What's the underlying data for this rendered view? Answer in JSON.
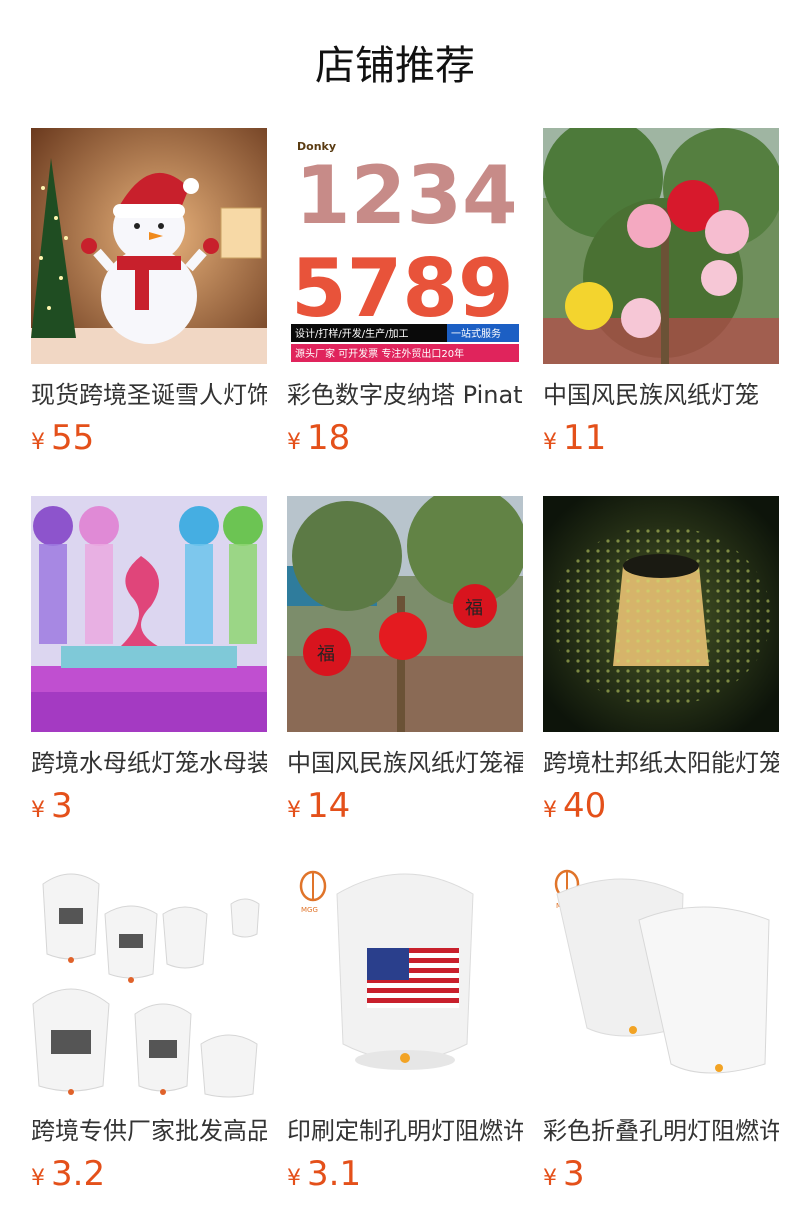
{
  "section_title": "店铺推荐",
  "currency_symbol": "¥",
  "accent_color": "#e4501a",
  "products": [
    {
      "name": "现货跨境圣诞雪人灯饰",
      "price": "55",
      "image": "snowman-lamp-image"
    },
    {
      "name": "彩色数字皮纳塔 Pinata",
      "price": "18",
      "image": "number-pinata-image"
    },
    {
      "name": "中国风民族风纸灯笼",
      "price": "11",
      "image": "paper-lantern-tree-image",
      "image_text": {
        "banner1": "设计/打样/开发/生产/加工",
        "banner2": "一站式服务"
      }
    },
    {
      "name": "跨境水母纸灯笼水母装饰",
      "price": "3",
      "image": "jellyfish-lantern-image"
    },
    {
      "name": "中国风民族风纸灯笼福字",
      "price": "14",
      "image": "fu-lantern-image"
    },
    {
      "name": "跨境杜邦纸太阳能灯笼",
      "price": "40",
      "image": "solar-lantern-image"
    },
    {
      "name": "跨境专供厂家批发高品质孔明灯",
      "price": "3.2",
      "image": "sky-lanterns-image"
    },
    {
      "name": "印刷定制孔明灯阻燃许愿灯",
      "price": "3.1",
      "image": "flag-sky-lantern-image"
    },
    {
      "name": "彩色折叠孔明灯阻燃许愿灯",
      "price": "3",
      "image": "white-sky-lanterns-image"
    }
  ],
  "image_texts": {
    "pinata_top": "1234",
    "pinata_bottom": "5789",
    "pinata_logo": "Donky",
    "pinata_banner_1": "设计/打样/开发/生产/加工",
    "pinata_banner_1b": "一站式服务",
    "pinata_banner_2": "源头厂家  可开发票  专注外贸出口20年",
    "brand_logo": "MGG",
    "fu": "福"
  }
}
